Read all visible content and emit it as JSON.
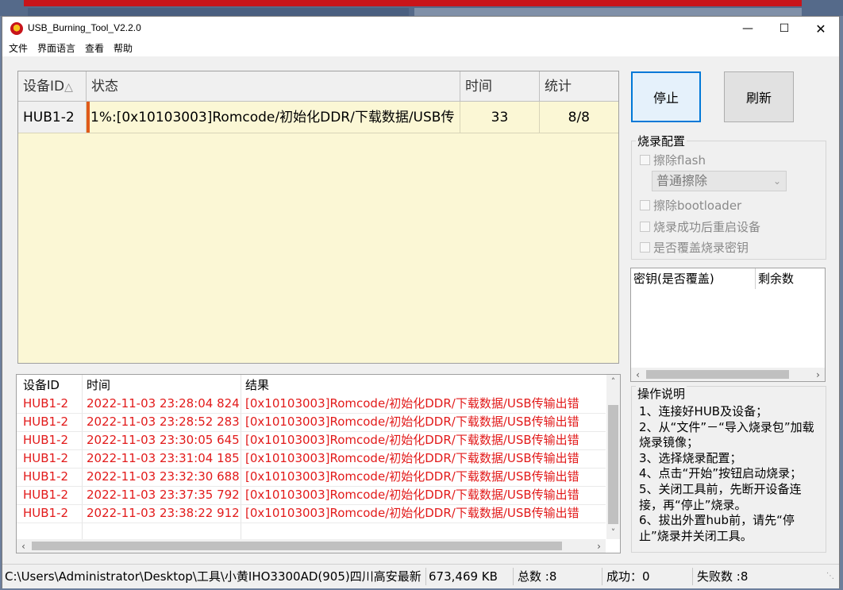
{
  "window": {
    "title": "USB_Burning_Tool_V2.2.0"
  },
  "menu": [
    "文件",
    "界面语言",
    "查看",
    "帮助"
  ],
  "device_grid": {
    "headers": {
      "id": "设备ID",
      "status": "状态",
      "time": "时间",
      "stats": "统计"
    },
    "rows": [
      {
        "id": "HUB1-2",
        "status": "1%:[0x10103003]Romcode/初始化DDR/下载数据/USB传",
        "time": "33",
        "stats": "8/8"
      }
    ]
  },
  "buttons": {
    "stop": "停止",
    "refresh": "刷新"
  },
  "config": {
    "title": "烧录配置",
    "erase_flash": "擦除flash",
    "erase_mode": "普通擦除",
    "erase_bootloader": "擦除bootloader",
    "reboot_after": "烧录成功后重启设备",
    "overwrite_key": "是否覆盖烧录密钥"
  },
  "keys": {
    "col_key": "密钥(是否覆盖)",
    "col_remaining": "剩余数"
  },
  "log": {
    "headers": {
      "id": "设备ID",
      "time": "时间",
      "result": "结果"
    },
    "rows": [
      {
        "id": "HUB1-2",
        "time": "2022-11-03 23:28:04 824",
        "result": "[0x10103003]Romcode/初始化DDR/下载数据/USB传输出错"
      },
      {
        "id": "HUB1-2",
        "time": "2022-11-03 23:28:52 283",
        "result": "[0x10103003]Romcode/初始化DDR/下载数据/USB传输出错"
      },
      {
        "id": "HUB1-2",
        "time": "2022-11-03 23:30:05 645",
        "result": "[0x10103003]Romcode/初始化DDR/下载数据/USB传输出错"
      },
      {
        "id": "HUB1-2",
        "time": "2022-11-03 23:31:04 185",
        "result": "[0x10103003]Romcode/初始化DDR/下载数据/USB传输出错"
      },
      {
        "id": "HUB1-2",
        "time": "2022-11-03 23:32:30 688",
        "result": "[0x10103003]Romcode/初始化DDR/下载数据/USB传输出错"
      },
      {
        "id": "HUB1-2",
        "time": "2022-11-03 23:37:35 792",
        "result": "[0x10103003]Romcode/初始化DDR/下载数据/USB传输出错"
      },
      {
        "id": "HUB1-2",
        "time": "2022-11-03 23:38:22 912",
        "result": "[0x10103003]Romcode/初始化DDR/下载数据/USB传输出错"
      }
    ]
  },
  "help": {
    "title": "操作说明",
    "text": "1、连接好HUB及设备；\n2、从“文件”－“导入烧录包”加载烧录镜像；\n3、选择烧录配置；\n4、点击“开始”按钮启动烧录；\n5、关闭工具前，先断开设备连接，再“停止”烧录。\n6、拔出外置hub前，请先“停止”烧录并关闭工具。"
  },
  "status": {
    "path": "C:\\Users\\Administrator\\Desktop\\工具\\小黄IHO3300AD(905)四川高安最新",
    "size": "673,469 KB",
    "total": "总数 :8",
    "success": "成功：0",
    "fail": "失败数 :8"
  },
  "colors": {
    "accent": "#0078d7",
    "error_text": "#e21a1a",
    "grid_bg": "#fbf7d5",
    "progress_bar": "#e05a1a"
  }
}
